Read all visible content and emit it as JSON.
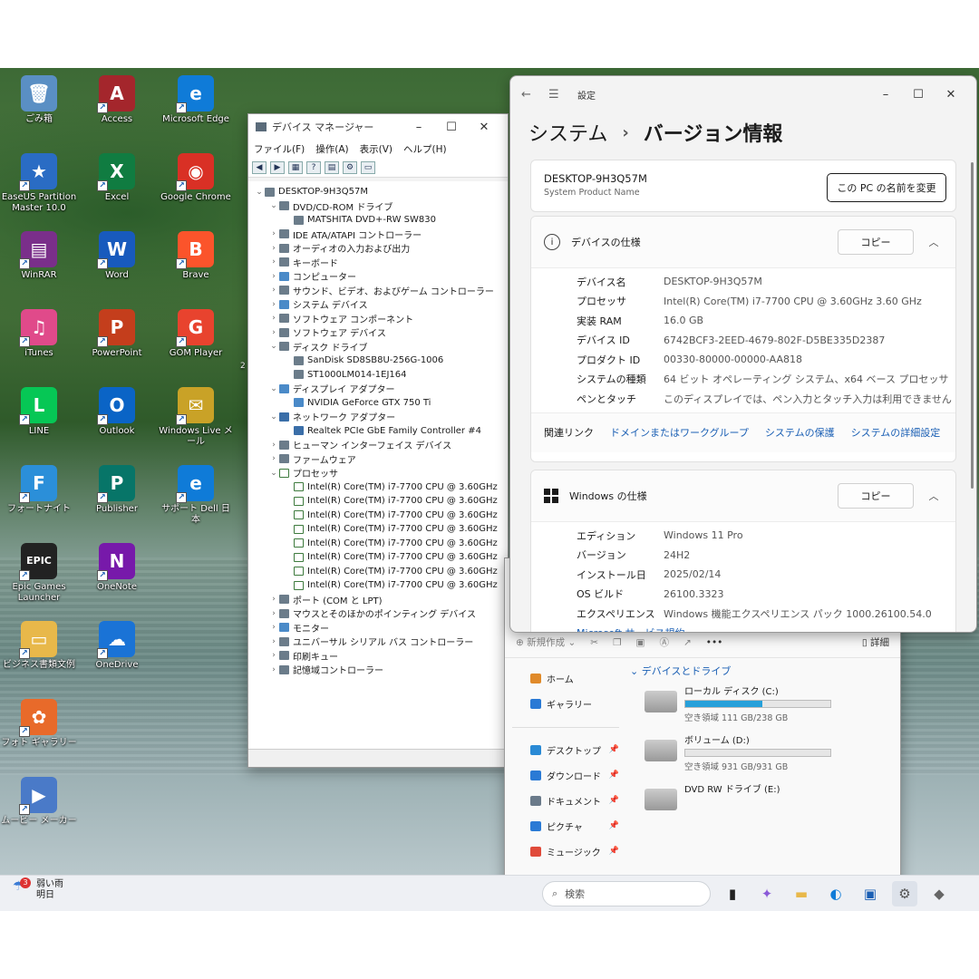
{
  "desktop": {
    "icons": [
      {
        "label": "ごみ箱",
        "glyph": "🗑",
        "color": "#5a8fc4"
      },
      {
        "label": "Access",
        "glyph": "A",
        "color": "#a4262c"
      },
      {
        "label": "Microsoft Edge",
        "glyph": "e",
        "color": "#0f7bd8"
      },
      {
        "label": "EaseUS Partition Master 10.0",
        "glyph": "★",
        "color": "#2a6cc4"
      },
      {
        "label": "Excel",
        "glyph": "X",
        "color": "#107c41"
      },
      {
        "label": "Google Chrome",
        "glyph": "◉",
        "color": "#d93025"
      },
      {
        "label": "WinRAR",
        "glyph": "▤",
        "color": "#7a2f8a"
      },
      {
        "label": "Word",
        "glyph": "W",
        "color": "#185abd"
      },
      {
        "label": "Brave",
        "glyph": "B",
        "color": "#fb542b"
      },
      {
        "label": "iTunes",
        "glyph": "♫",
        "color": "#e04a8a"
      },
      {
        "label": "PowerPoint",
        "glyph": "P",
        "color": "#c43e1c"
      },
      {
        "label": "GOM Player",
        "glyph": "G",
        "color": "#e8432e"
      },
      {
        "label": "LINE",
        "glyph": "L",
        "color": "#06c755"
      },
      {
        "label": "Outlook",
        "glyph": "O",
        "color": "#0a64c6"
      },
      {
        "label": "Windows Live メール",
        "glyph": "✉",
        "color": "#c9a227"
      },
      {
        "label": "フォートナイト",
        "glyph": "F",
        "color": "#2b8fd9"
      },
      {
        "label": "Publisher",
        "glyph": "P",
        "color": "#077568"
      },
      {
        "label": "サポート Dell 日本",
        "glyph": "e",
        "color": "#0f7bd8"
      },
      {
        "label": "Epic Games Launcher",
        "glyph": "EPIC",
        "color": "#222222"
      },
      {
        "label": "OneNote",
        "glyph": "N",
        "color": "#7719aa"
      },
      {
        "label": "ビジネス書類文例",
        "glyph": "▭",
        "color": "#e8b84a"
      },
      {
        "label": "OneDrive",
        "glyph": "☁",
        "color": "#1a73d6"
      },
      {
        "label": "フォト ギャラリー",
        "glyph": "✿",
        "color": "#e86a2a"
      },
      {
        "label": "ムービー メーカー",
        "glyph": "▶",
        "color": "#4a7ac8"
      }
    ],
    "stray": "2"
  },
  "device_manager": {
    "title": "デバイス マネージャー",
    "menu": [
      "ファイル(F)",
      "操作(A)",
      "表示(V)",
      "ヘルプ(H)"
    ],
    "tree": [
      {
        "depth": 0,
        "exp": "⌄",
        "label": "DESKTOP-9H3Q57M",
        "kind": "pc"
      },
      {
        "depth": 1,
        "exp": "⌄",
        "label": "DVD/CD-ROM ドライブ",
        "kind": ""
      },
      {
        "depth": 2,
        "exp": "",
        "label": "MATSHITA DVD+-RW SW830",
        "kind": ""
      },
      {
        "depth": 1,
        "exp": "›",
        "label": "IDE ATA/ATAPI コントローラー",
        "kind": ""
      },
      {
        "depth": 1,
        "exp": "›",
        "label": "オーディオの入力および出力",
        "kind": ""
      },
      {
        "depth": 1,
        "exp": "›",
        "label": "キーボード",
        "kind": ""
      },
      {
        "depth": 1,
        "exp": "›",
        "label": "コンピューター",
        "kind": "disp"
      },
      {
        "depth": 1,
        "exp": "›",
        "label": "サウンド、ビデオ、およびゲーム コントローラー",
        "kind": ""
      },
      {
        "depth": 1,
        "exp": "›",
        "label": "システム デバイス",
        "kind": "disp"
      },
      {
        "depth": 1,
        "exp": "›",
        "label": "ソフトウェア コンポーネント",
        "kind": ""
      },
      {
        "depth": 1,
        "exp": "›",
        "label": "ソフトウェア デバイス",
        "kind": ""
      },
      {
        "depth": 1,
        "exp": "⌄",
        "label": "ディスク ドライブ",
        "kind": ""
      },
      {
        "depth": 2,
        "exp": "",
        "label": "SanDisk SD8SB8U-256G-1006",
        "kind": ""
      },
      {
        "depth": 2,
        "exp": "",
        "label": "ST1000LM014-1EJ164",
        "kind": ""
      },
      {
        "depth": 1,
        "exp": "⌄",
        "label": "ディスプレイ アダプター",
        "kind": "disp"
      },
      {
        "depth": 2,
        "exp": "",
        "label": "NVIDIA GeForce GTX 750 Ti",
        "kind": "disp"
      },
      {
        "depth": 1,
        "exp": "⌄",
        "label": "ネットワーク アダプター",
        "kind": "net"
      },
      {
        "depth": 2,
        "exp": "",
        "label": "Realtek PCIe GbE Family Controller #4",
        "kind": "net"
      },
      {
        "depth": 1,
        "exp": "›",
        "label": "ヒューマン インターフェイス デバイス",
        "kind": ""
      },
      {
        "depth": 1,
        "exp": "›",
        "label": "ファームウェア",
        "kind": ""
      },
      {
        "depth": 1,
        "exp": "⌄",
        "label": "プロセッサ",
        "kind": "cpu"
      },
      {
        "depth": 2,
        "exp": "",
        "label": "Intel(R) Core(TM) i7-7700 CPU @ 3.60GHz",
        "kind": "cpu"
      },
      {
        "depth": 2,
        "exp": "",
        "label": "Intel(R) Core(TM) i7-7700 CPU @ 3.60GHz",
        "kind": "cpu"
      },
      {
        "depth": 2,
        "exp": "",
        "label": "Intel(R) Core(TM) i7-7700 CPU @ 3.60GHz",
        "kind": "cpu"
      },
      {
        "depth": 2,
        "exp": "",
        "label": "Intel(R) Core(TM) i7-7700 CPU @ 3.60GHz",
        "kind": "cpu"
      },
      {
        "depth": 2,
        "exp": "",
        "label": "Intel(R) Core(TM) i7-7700 CPU @ 3.60GHz",
        "kind": "cpu"
      },
      {
        "depth": 2,
        "exp": "",
        "label": "Intel(R) Core(TM) i7-7700 CPU @ 3.60GHz",
        "kind": "cpu"
      },
      {
        "depth": 2,
        "exp": "",
        "label": "Intel(R) Core(TM) i7-7700 CPU @ 3.60GHz",
        "kind": "cpu"
      },
      {
        "depth": 2,
        "exp": "",
        "label": "Intel(R) Core(TM) i7-7700 CPU @ 3.60GHz",
        "kind": "cpu"
      },
      {
        "depth": 1,
        "exp": "›",
        "label": "ポート (COM と LPT)",
        "kind": ""
      },
      {
        "depth": 1,
        "exp": "›",
        "label": "マウスとそのほかのポインティング デバイス",
        "kind": ""
      },
      {
        "depth": 1,
        "exp": "›",
        "label": "モニター",
        "kind": "disp"
      },
      {
        "depth": 1,
        "exp": "›",
        "label": "ユニバーサル シリアル バス コントローラー",
        "kind": ""
      },
      {
        "depth": 1,
        "exp": "›",
        "label": "印刷キュー",
        "kind": ""
      },
      {
        "depth": 1,
        "exp": "›",
        "label": "記憶域コントローラー",
        "kind": ""
      }
    ]
  },
  "explorer": {
    "new_label": "新規作成",
    "more_label": "•••",
    "details_label": "詳細",
    "nav_top": [
      {
        "label": "ホーム",
        "color": "#e08a2a"
      },
      {
        "label": "ギャラリー",
        "color": "#2a7ad5"
      }
    ],
    "nav_pinned": [
      {
        "label": "デスクトップ",
        "color": "#2a8ad5"
      },
      {
        "label": "ダウンロード",
        "color": "#2a7ad5"
      },
      {
        "label": "ドキュメント",
        "color": "#6a7a8a"
      },
      {
        "label": "ピクチャ",
        "color": "#2a7ad5"
      },
      {
        "label": "ミュージック",
        "color": "#e04a3a"
      }
    ],
    "section": "デバイスとドライブ",
    "drives": [
      {
        "name": "ローカル ディスク (C:)",
        "free": "空き領域 111 GB/238 GB",
        "used_fraction": 0.53
      },
      {
        "name": "ボリューム (D:)",
        "free": "空き領域 931 GB/931 GB",
        "used_fraction": 0.0
      },
      {
        "name": "DVD RW ドライブ (E:)",
        "free": "",
        "used_fraction": null
      }
    ]
  },
  "settings": {
    "app": "設定",
    "crumb_parent": "システム",
    "crumb_sep": "›",
    "crumb_current": "バージョン情報",
    "device_name": "DESKTOP-9H3Q57M",
    "device_sub": "System Product Name",
    "rename_button": "この PC の名前を変更",
    "device_specs": {
      "title": "デバイスの仕様",
      "copy": "コピー",
      "rows": [
        {
          "k": "デバイス名",
          "v": "DESKTOP-9H3Q57M"
        },
        {
          "k": "プロセッサ",
          "v": "Intel(R) Core(TM) i7-7700 CPU @ 3.60GHz   3.60 GHz"
        },
        {
          "k": "実装 RAM",
          "v": "16.0 GB"
        },
        {
          "k": "デバイス ID",
          "v": "6742BCF3-2EED-4679-802F-D5BE335D2387"
        },
        {
          "k": "プロダクト ID",
          "v": "00330-80000-00000-AA818"
        },
        {
          "k": "システムの種類",
          "v": "64 ビット オペレーティング システム、x64 ベース プロセッサ"
        },
        {
          "k": "ペンとタッチ",
          "v": "このディスプレイでは、ペン入力とタッチ入力は利用できません"
        }
      ]
    },
    "related": {
      "label": "関連リンク",
      "links": [
        "ドメインまたはワークグループ",
        "システムの保護",
        "システムの詳細設定"
      ]
    },
    "windows_specs": {
      "title": "Windows の仕様",
      "copy": "コピー",
      "rows": [
        {
          "k": "エディション",
          "v": "Windows 11 Pro"
        },
        {
          "k": "バージョン",
          "v": "24H2"
        },
        {
          "k": "インストール日",
          "v": "2025/02/14"
        },
        {
          "k": "OS ビルド",
          "v": "26100.3323"
        },
        {
          "k": "エクスペリエンス",
          "v": "Windows 機能エクスペリエンス パック 1000.26100.54.0"
        }
      ],
      "tail": "Microsoft サービス規約"
    }
  },
  "taskbar": {
    "weather_badge": "3",
    "weather_line1": "弱い雨",
    "weather_line2": "明日",
    "search_placeholder": "検索",
    "apps": [
      "task-view-icon",
      "copilot-icon",
      "file-explorer-icon",
      "edge-icon",
      "store-icon",
      "settings-icon",
      "app-icon"
    ]
  }
}
